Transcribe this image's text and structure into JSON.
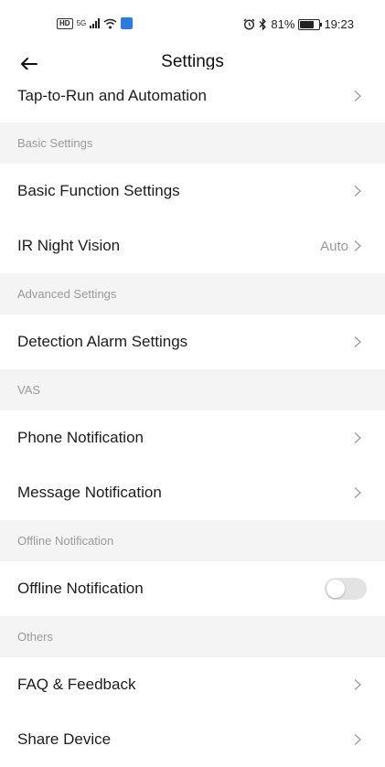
{
  "status_bar": {
    "hd_label": "HD",
    "network_label": "5G",
    "battery_percent": "81%",
    "battery_level": 0.81,
    "time": "19:23"
  },
  "header": {
    "title": "Settings"
  },
  "rows": {
    "tap_to_run": {
      "label": "Tap-to-Run and Automation"
    },
    "basic_function": {
      "label": "Basic Function Settings"
    },
    "ir_night_vision": {
      "label": "IR Night Vision",
      "value": "Auto"
    },
    "detection_alarm": {
      "label": "Detection Alarm Settings"
    },
    "phone_notification": {
      "label": "Phone Notification"
    },
    "message_notification": {
      "label": "Message Notification"
    },
    "offline_notification": {
      "label": "Offline Notification",
      "enabled": false
    },
    "faq_feedback": {
      "label": "FAQ & Feedback"
    },
    "share_device": {
      "label": "Share Device"
    }
  },
  "sections": {
    "basic": "Basic Settings",
    "advanced": "Advanced Settings",
    "vas": "VAS",
    "offline": "Offline Notification",
    "others": "Others"
  },
  "colors": {
    "section_bg": "#f4f4f4",
    "muted_text": "#9a9a9a",
    "toggle_off": "#e3e3e3"
  }
}
